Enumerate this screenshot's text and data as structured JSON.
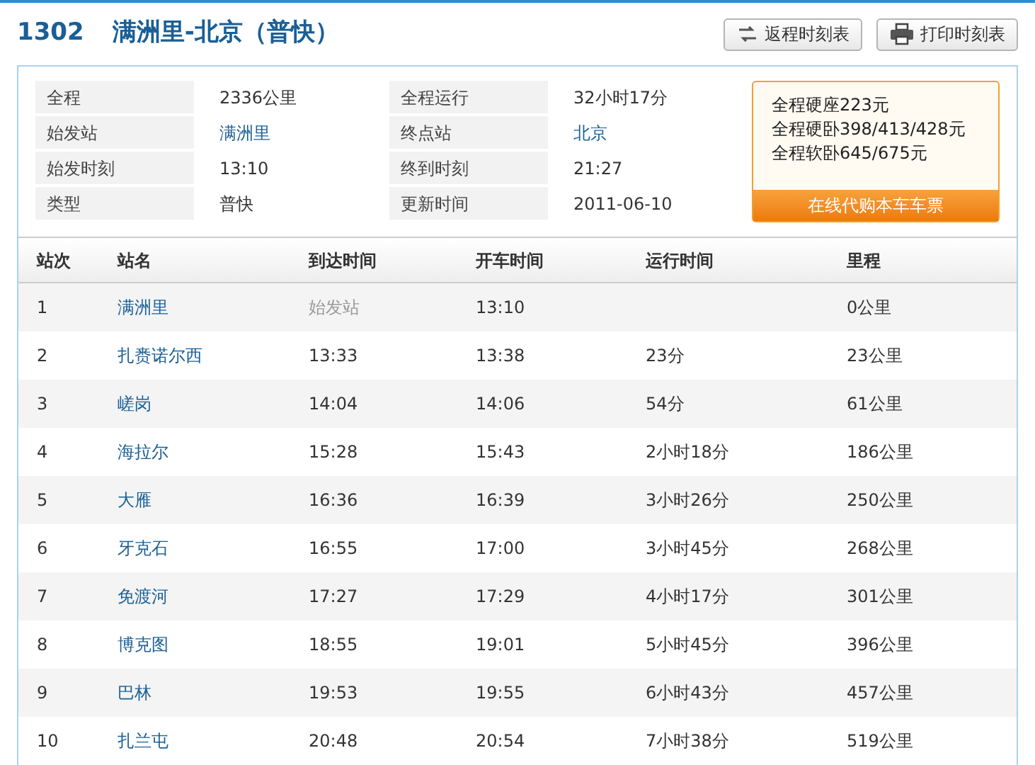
{
  "header": {
    "train": "1302",
    "route": "满洲里-北京（普快）",
    "buttons": [
      {
        "label": "返程时刻表",
        "kind": "return"
      },
      {
        "label": "打印时刻表",
        "kind": "print"
      }
    ]
  },
  "info": [
    {
      "label": "全程",
      "value": "2336公里",
      "link": false
    },
    {
      "label": "全程运行",
      "value": "32小时17分",
      "link": false
    },
    {
      "label": "始发站",
      "value": "满洲里",
      "link": true
    },
    {
      "label": "终点站",
      "value": "北京",
      "link": true
    },
    {
      "label": "始发时刻",
      "value": "13:10",
      "link": false
    },
    {
      "label": "终到时刻",
      "value": "21:27",
      "link": false
    },
    {
      "label": "类型",
      "value": "普快",
      "link": false
    },
    {
      "label": "更新时间",
      "value": "2011-06-10",
      "link": false
    }
  ],
  "prices": [
    "全程硬座223元",
    "全程硬卧398/413/428元",
    "全程软卧645/675元"
  ],
  "buy_button": "在线代购本车车票",
  "table": {
    "columns": [
      "站次",
      "站名",
      "到达时间",
      "开车时间",
      "运行时间",
      "里程"
    ],
    "rows": [
      {
        "no": "1",
        "station": "满洲里",
        "arrive": "始发站",
        "arrive_muted": true,
        "depart": "13:10",
        "distance": "0公里"
      },
      {
        "no": "2",
        "station": "扎赉诺尔西",
        "arrive": "13:33",
        "arrive_muted": false,
        "depart": "13:38",
        "duration": "23分",
        "distance": "23公里"
      },
      {
        "no": "3",
        "station": "嵯岗",
        "arrive": "14:04",
        "arrive_muted": false,
        "depart": "14:06",
        "duration": "54分",
        "distance": "61公里"
      },
      {
        "no": "4",
        "station": "海拉尔",
        "arrive": "15:28",
        "arrive_muted": false,
        "depart": "15:43",
        "duration": "2小时18分",
        "distance": "186公里"
      },
      {
        "no": "5",
        "station": "大雁",
        "arrive": "16:36",
        "arrive_muted": false,
        "depart": "16:39",
        "duration": "3小时26分",
        "distance": "250公里"
      },
      {
        "no": "6",
        "station": "牙克石",
        "arrive": "16:55",
        "arrive_muted": false,
        "depart": "17:00",
        "duration": "3小时45分",
        "distance": "268公里"
      },
      {
        "no": "7",
        "station": "免渡河",
        "arrive": "17:27",
        "arrive_muted": false,
        "depart": "17:29",
        "duration": "4小时17分",
        "distance": "301公里"
      },
      {
        "no": "8",
        "station": "博克图",
        "arrive": "18:55",
        "arrive_muted": false,
        "depart": "19:01",
        "duration": "5小时45分",
        "distance": "396公里"
      },
      {
        "no": "9",
        "station": "巴林",
        "arrive": "19:53",
        "arrive_muted": false,
        "depart": "19:55",
        "duration": "6小时43分",
        "distance": "457公里"
      },
      {
        "no": "10",
        "station": "扎兰屯",
        "arrive": "20:48",
        "arrive_muted": false,
        "depart": "20:54",
        "duration": "7小时38分",
        "distance": "519公里"
      }
    ]
  }
}
